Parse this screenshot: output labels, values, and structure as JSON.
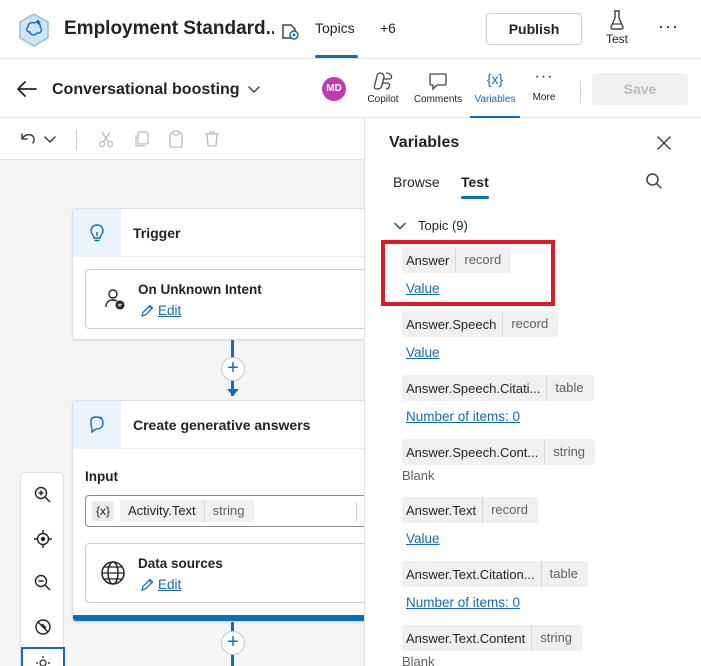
{
  "header": {
    "app_title": "Employment Standard...",
    "tabs": {
      "topics": "Topics",
      "more": "+6"
    },
    "publish_label": "Publish",
    "test_label": "Test",
    "more_icon": "ellipsis-icon"
  },
  "topic_bar": {
    "topic_name": "Conversational boosting",
    "avatar_initials": "MD",
    "avatar_color": "#c239b3",
    "copilot_label": "Copilot",
    "comments_label": "Comments",
    "variables_label": "Variables",
    "more_label": "More",
    "variables_symbol": "{x}",
    "save_label": "Save"
  },
  "canvas": {
    "trigger": {
      "title": "Trigger",
      "intent_label": "On Unknown Intent",
      "edit_label": "Edit"
    },
    "generative": {
      "title": "Create generative answers",
      "input_label": "Input",
      "input_var_symbol": "{x}",
      "input_var_name": "Activity.Text",
      "input_var_type": "string",
      "data_sources_label": "Data sources",
      "edit_label": "Edit"
    },
    "accent_color": "#0f6cbd"
  },
  "variables_panel": {
    "title": "Variables",
    "tabs": {
      "browse": "Browse",
      "test": "Test"
    },
    "group_label": "Topic (9)",
    "items": [
      {
        "name": "Answer",
        "type": "record",
        "value": "Value",
        "value_kind": "link"
      },
      {
        "name": "Answer.Speech",
        "type": "record",
        "value": "Value",
        "value_kind": "link"
      },
      {
        "name": "Answer.Speech.Citati...",
        "type": "table",
        "value": "Number of items: 0",
        "value_kind": "link"
      },
      {
        "name": "Answer.Speech.Cont...",
        "type": "string",
        "value": "Blank",
        "value_kind": "text"
      },
      {
        "name": "Answer.Text",
        "type": "record",
        "value": "Value",
        "value_kind": "link"
      },
      {
        "name": "Answer.Text.Citation...",
        "type": "table",
        "value": "Number of items: 0",
        "value_kind": "link"
      },
      {
        "name": "Answer.Text.Content",
        "type": "string",
        "value": "Blank",
        "value_kind": "text"
      }
    ],
    "highlight_color": "#e01b24"
  }
}
